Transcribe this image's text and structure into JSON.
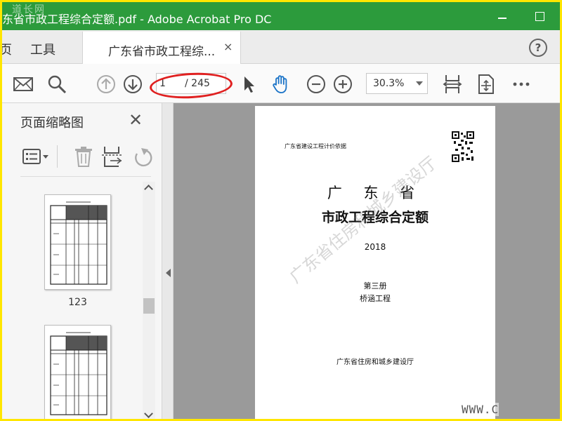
{
  "window": {
    "title": "东省市政工程综合定额.pdf - Adobe Acrobat Pro DC",
    "corner_watermark": "道长网"
  },
  "tabs": {
    "home": "页",
    "tools": "工具",
    "document": "广东省市政工程综...",
    "close": "×"
  },
  "toolbar": {
    "current_page": "1",
    "total_pages": "/ 245",
    "zoom": "30.3%",
    "highlight_color": "#e02020"
  },
  "panel": {
    "title": "页面缩略图",
    "close": "✕",
    "thumbnails": [
      {
        "label": "123"
      },
      {
        "label": ""
      }
    ]
  },
  "document": {
    "basis": "广东省建设工程计价依据",
    "title_line1": "广 东 省",
    "title_line2": "市政工程综合定额",
    "year": "2018",
    "volume": "第三册",
    "subject": "桥涵工程",
    "publisher": "广东省住房和城乡建设厅",
    "watermark": "广东省住房和城乡建设厅"
  },
  "footer": {
    "url_fragment": "WWW.C"
  },
  "colors": {
    "titlebar": "#2c9b3c",
    "frame_border": "#ffe600"
  },
  "icons": [
    "mail-icon",
    "search-icon",
    "arrow-up-icon",
    "arrow-down-icon",
    "pointer-icon",
    "hand-icon",
    "zoom-out-icon",
    "zoom-in-icon",
    "fit-width-icon",
    "fit-page-icon",
    "more-icon",
    "options-icon",
    "delete-icon",
    "extract-icon",
    "rotate-icon",
    "help-icon"
  ]
}
